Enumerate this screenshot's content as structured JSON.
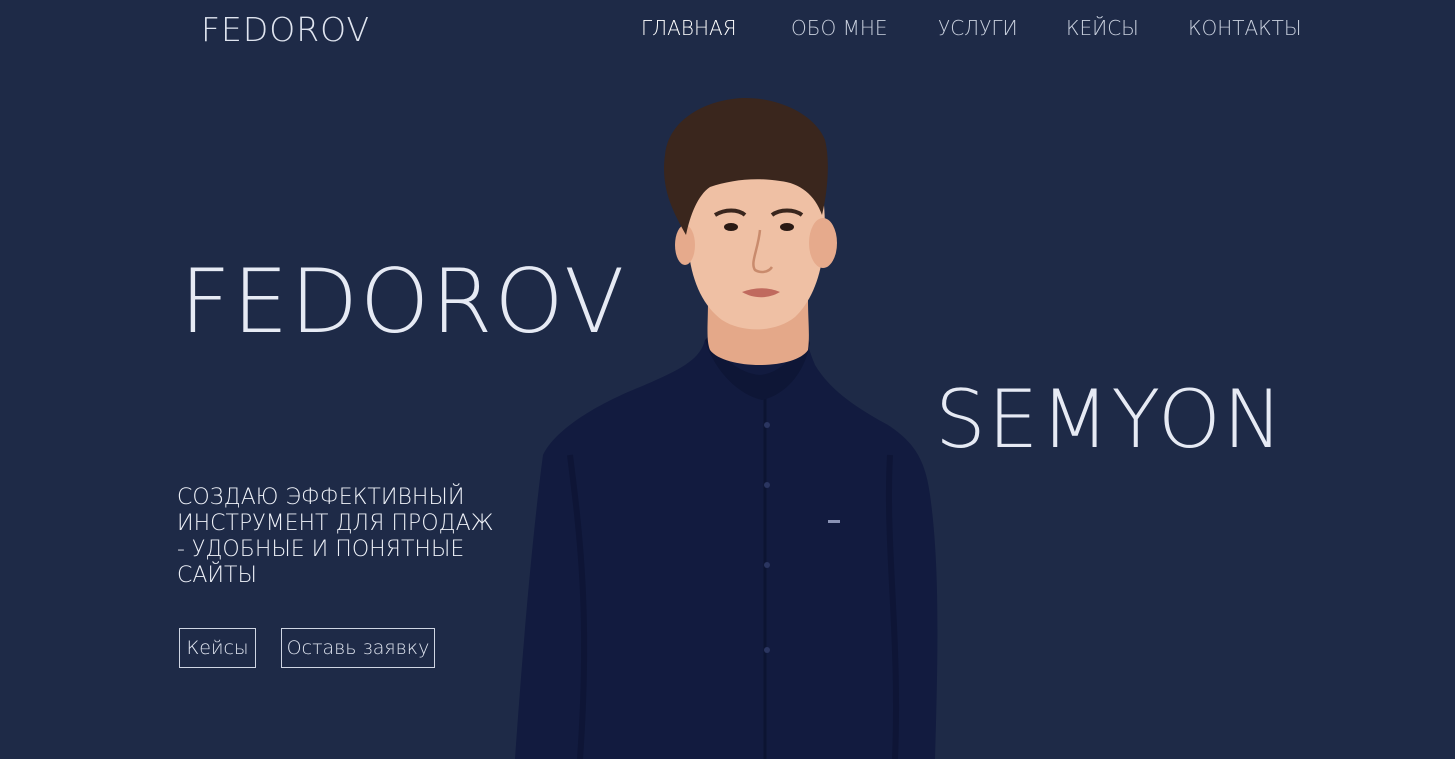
{
  "header": {
    "logo": "FEDOROV",
    "nav": [
      {
        "label": "ГЛАВНАЯ",
        "active": true
      },
      {
        "label": "ОБО МНЕ",
        "active": false
      },
      {
        "label": "УСЛУГИ",
        "active": false
      },
      {
        "label": "КЕЙСЫ",
        "active": false
      },
      {
        "label": "КОНТАКТЫ",
        "active": false
      }
    ]
  },
  "hero": {
    "last_name": "FEDOROV",
    "first_name": "SEMYON",
    "tagline": "СОЗДАЮ ЭФФЕКТИВНЫЙ ИНСТРУМЕНТ ДЛЯ ПРОДАЖ - УДОБНЫЕ И ПОНЯТНЫЕ САЙТЫ",
    "buttons": {
      "cases": "Кейсы",
      "request": "Оставь заявку"
    }
  },
  "colors": {
    "background": "#1e2a47",
    "text": "#e6eaf4",
    "shirt": "#111a3d"
  }
}
